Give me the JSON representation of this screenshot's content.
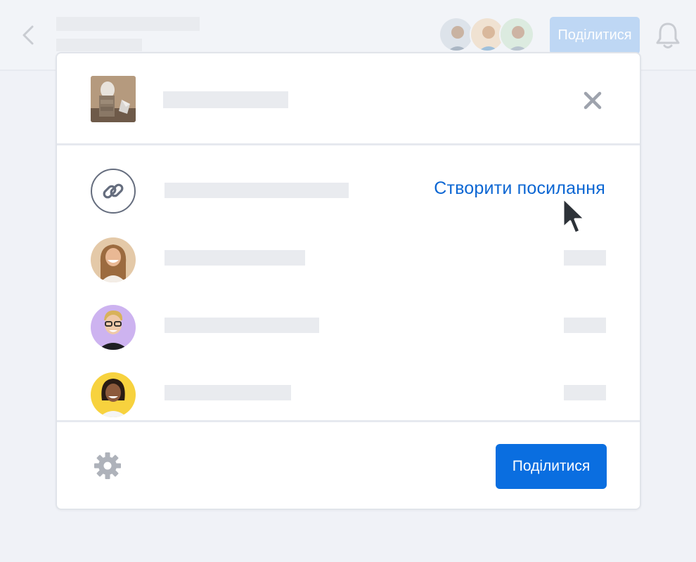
{
  "topbar": {
    "share_label": "Поділитися",
    "icons": [
      "chevron-left-icon",
      "bell-icon"
    ]
  },
  "dialog": {
    "create_link_label": "Створити посилання",
    "share_label": "Поділитися",
    "icons": [
      "close-icon",
      "link-icon",
      "gear-icon",
      "cursor-icon"
    ]
  },
  "colors": {
    "accent": "#0a6ee0",
    "link_text": "#0b66d3",
    "placeholder": "#e9ebef",
    "background": "#f0f2f7"
  }
}
